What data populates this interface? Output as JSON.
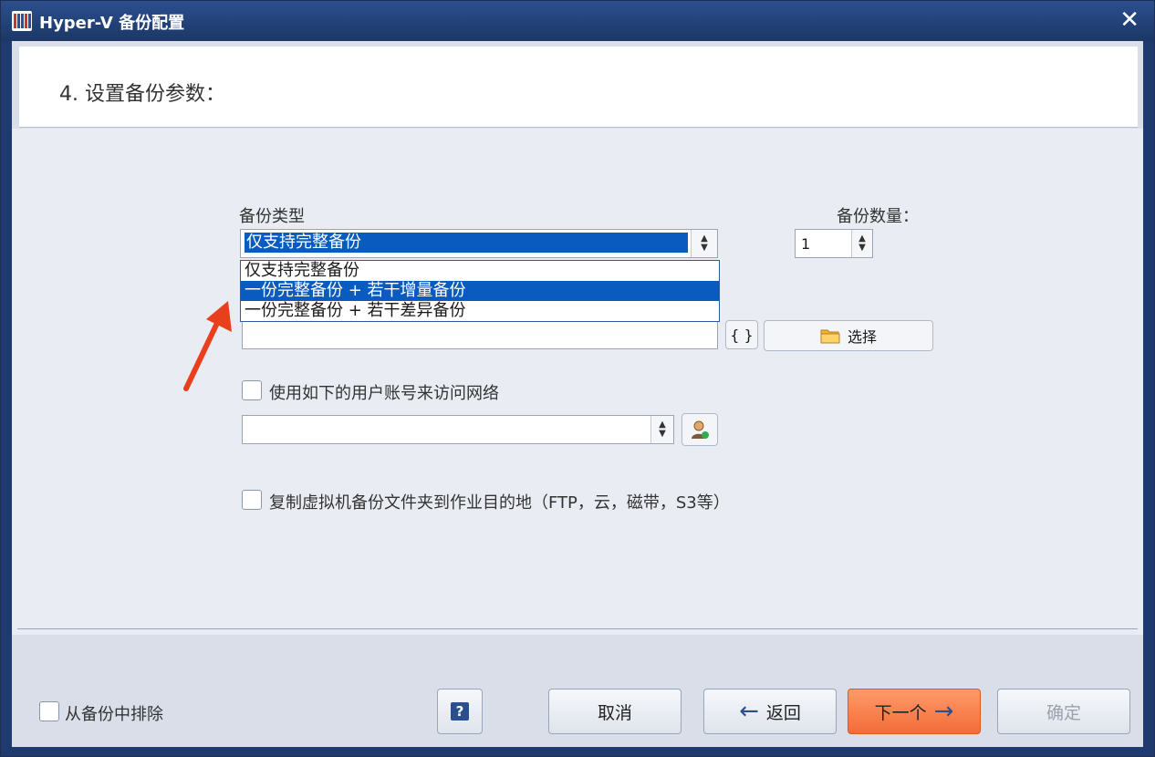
{
  "window": {
    "title": "Hyper-V 备份配置",
    "close_glyph": "✕"
  },
  "header": {
    "title": "4. 设置备份参数："
  },
  "backup_type": {
    "label": "备份类型",
    "selected": "仅支持完整备份",
    "options": [
      "仅支持完整备份",
      "一份完整备份 + 若干增量备份",
      "一份完整备份 + 若干差异备份"
    ],
    "highlighted_index": 1
  },
  "backup_count": {
    "label": "备份数量：",
    "value": "1"
  },
  "destination": {
    "braces_label": "{ }",
    "select_label": "选择"
  },
  "network_account": {
    "checkbox_label": "使用如下的用户账号来访问网络",
    "checked": false
  },
  "copy_option": {
    "checkbox_label": "复制虚拟机备份文件夹到作业目的地（FTP，云，磁带，S3等）",
    "checked": false
  },
  "footer": {
    "exclude_label": "从备份中排除",
    "help_label": "?",
    "cancel_label": "取消",
    "back_label": "返回",
    "next_label": "下一个",
    "ok_label": "确定"
  }
}
